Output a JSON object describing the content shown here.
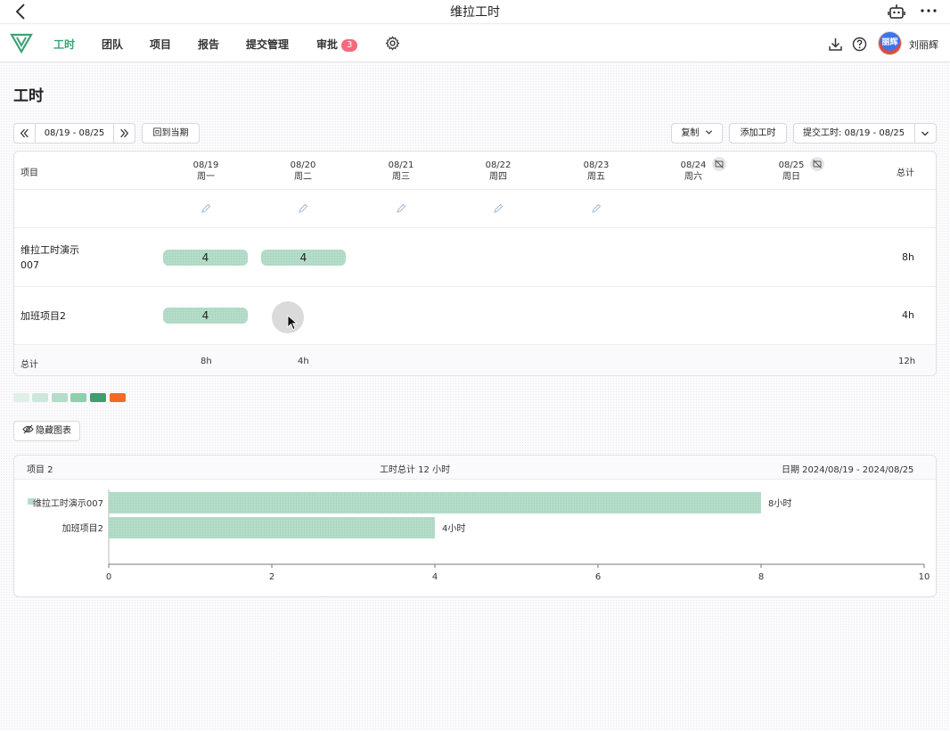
{
  "app": {
    "title": "维拉工时"
  },
  "nav": {
    "items": [
      {
        "label": "工时",
        "active": true
      },
      {
        "label": "团队"
      },
      {
        "label": "项目"
      },
      {
        "label": "报告"
      },
      {
        "label": "提交管理"
      },
      {
        "label": "审批",
        "badge": "3"
      }
    ],
    "user": {
      "name": "刘丽辉",
      "avatar_text": "丽辉"
    }
  },
  "page": {
    "title": "工时"
  },
  "toolbar": {
    "range": "08/19 - 08/25",
    "back_to_current": "回到当期",
    "copy": "复制",
    "add_hours": "添加工时",
    "submit": "提交工时: 08/19 - 08/25"
  },
  "table": {
    "project_header": "项目",
    "total_header": "总计",
    "days": [
      {
        "date": "08/19",
        "weekday": "周一"
      },
      {
        "date": "08/20",
        "weekday": "周二"
      },
      {
        "date": "08/21",
        "weekday": "周三"
      },
      {
        "date": "08/22",
        "weekday": "周四"
      },
      {
        "date": "08/23",
        "weekday": "周五"
      },
      {
        "date": "08/24",
        "weekday": "周六",
        "no_report": true
      },
      {
        "date": "08/25",
        "weekday": "周日",
        "no_report": true
      }
    ],
    "rows": [
      {
        "name": "维拉工时演示",
        "name2": "007",
        "hours": [
          "4",
          "4"
        ],
        "total": "8h"
      },
      {
        "name": "加班项目2",
        "hours": [
          "4"
        ],
        "total": "4h"
      }
    ],
    "footer": {
      "label": "总计",
      "day_totals": [
        "8h",
        "4h"
      ],
      "total": "12h"
    }
  },
  "legend": {
    "colors": [
      "#dff0e8",
      "#cde8db",
      "#b4dcc9",
      "#8fcfae",
      "#3d9e6e",
      "#f26a24"
    ]
  },
  "hide_chart": "隐藏图表",
  "summary": {
    "projects": "项目 2",
    "total_hours": "工时总计 12 小时",
    "date_range": "日期 2024/08/19 - 2024/08/25"
  },
  "chart_data": {
    "type": "bar",
    "orientation": "horizontal",
    "categories": [
      "维拉工时演示007",
      "加班项目2"
    ],
    "values": [
      8,
      4
    ],
    "value_labels": [
      "8小时",
      "4小时"
    ],
    "xlim": [
      0,
      10
    ],
    "xticks": [
      0,
      2,
      4,
      6,
      8,
      10
    ],
    "color": "#b4dcc9"
  }
}
